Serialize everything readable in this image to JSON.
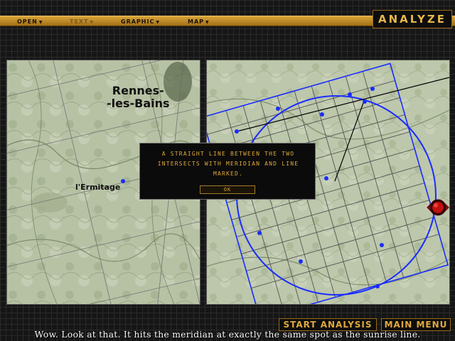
{
  "header": {
    "title": "ANALYZE",
    "menu": [
      {
        "label": "OPEN",
        "enabled": true
      },
      {
        "label": "TEXT",
        "enabled": false
      },
      {
        "label": "GRAPHIC",
        "enabled": true
      },
      {
        "label": "MAP",
        "enabled": true
      }
    ]
  },
  "left_map": {
    "town_line1": "Rennes-",
    "town_line2": "-les-Bains",
    "point_label": "l'Ermitage"
  },
  "dialog": {
    "message": "A straight line between the two intersects with meridian and line marked.",
    "ok_label": "OK"
  },
  "buttons": {
    "start_analysis": "START ANALYSIS",
    "main_menu": "MAIN MENU"
  },
  "subtitle": "Wow.  Look at that.  It hits the meridian at exactly the same spot as the sunrise line.",
  "colors": {
    "accent": "#e0a93b",
    "menu_bar": "#c48f2b",
    "overlay_blue": "#1a2cff",
    "map_green": "#b9c4a7"
  },
  "icons": {
    "knob": "red-knob-icon",
    "menu_caret": "caret-down-icon"
  }
}
